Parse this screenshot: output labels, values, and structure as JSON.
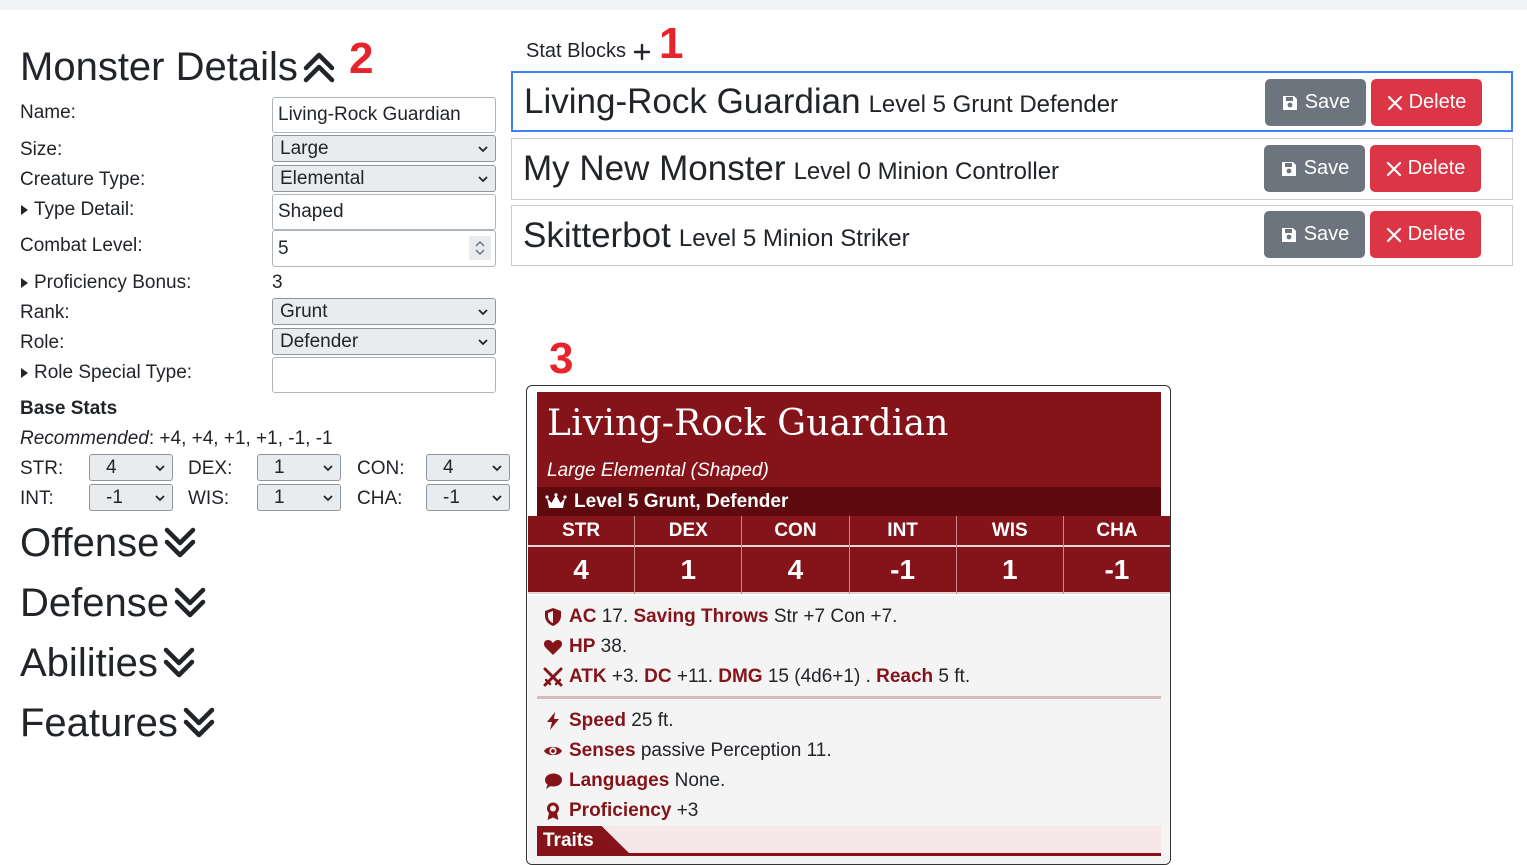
{
  "annotations": {
    "a1": "1",
    "a2": "2",
    "a3": "3"
  },
  "details": {
    "title": "Monster Details",
    "name_label": "Name:",
    "name_value": "Living-Rock Guardian",
    "size_label": "Size:",
    "size_value": "Large",
    "type_label": "Creature Type:",
    "type_value": "Elemental",
    "type_detail_label": "Type Detail:",
    "type_detail_value": "Shaped",
    "level_label": "Combat Level:",
    "level_value": "5",
    "prof_label": "Proficiency Bonus:",
    "prof_value": "3",
    "rank_label": "Rank:",
    "rank_value": "Grunt",
    "role_label": "Role:",
    "role_value": "Defender",
    "role_special_label": "Role Special Type:",
    "role_special_value": "",
    "base_stats_label": "Base Stats",
    "recommended_label": "Recommended",
    "recommended_value": ": +4, +4, +1, +1, -1, -1",
    "stats": [
      {
        "label": "STR:",
        "value": "4"
      },
      {
        "label": "DEX:",
        "value": "1"
      },
      {
        "label": "CON:",
        "value": "4"
      },
      {
        "label": "INT:",
        "value": "-1"
      },
      {
        "label": "WIS:",
        "value": "1"
      },
      {
        "label": "CHA:",
        "value": "-1"
      }
    ]
  },
  "sections": [
    "Offense",
    "Defense",
    "Abilities",
    "Features"
  ],
  "stat_blocks": {
    "header": "Stat Blocks",
    "save_label": "Save",
    "delete_label": "Delete",
    "items": [
      {
        "name": "Living-Rock Guardian",
        "meta": "Level 5 Grunt Defender"
      },
      {
        "name": "My New Monster",
        "meta": "Level 0 Minion Controller"
      },
      {
        "name": "Skitterbot",
        "meta": "Level 5 Minion Striker"
      }
    ]
  },
  "card": {
    "name": "Living-Rock Guardian",
    "subtitle": "Large Elemental (Shaped)",
    "level_line": "Level 5 Grunt, Defender",
    "abilities": [
      {
        "h": "STR",
        "v": "4"
      },
      {
        "h": "DEX",
        "v": "1"
      },
      {
        "h": "CON",
        "v": "4"
      },
      {
        "h": "INT",
        "v": "-1"
      },
      {
        "h": "WIS",
        "v": "1"
      },
      {
        "h": "CHA",
        "v": "-1"
      }
    ],
    "ac_label": "AC",
    "ac_value": " 17. ",
    "saves_label": "Saving Throws",
    "saves_value": " Str +7 Con +7.",
    "hp_label": "HP",
    "hp_value": " 38.",
    "atk_label": "ATK",
    "atk_value": " +3. ",
    "dc_label": "DC",
    "dc_value": " +11. ",
    "dmg_label": "DMG",
    "dmg_value": " 15 (4d6+1) . ",
    "reach_label": "Reach",
    "reach_value": " 5 ft.",
    "speed_label": "Speed",
    "speed_value": " 25 ft.",
    "senses_label": "Senses",
    "senses_value": " passive Perception 11.",
    "languages_label": "Languages",
    "languages_value": " None.",
    "proficiency_label": "Proficiency",
    "proficiency_value": " +3",
    "traits_label": "Traits"
  },
  "colors": {
    "accent": "#85141a",
    "accent_dark": "#5e0a0e",
    "save": "#6c757d",
    "delete": "#dc3545",
    "active_border": "#3b82f6",
    "annotation": "#e8232b"
  }
}
